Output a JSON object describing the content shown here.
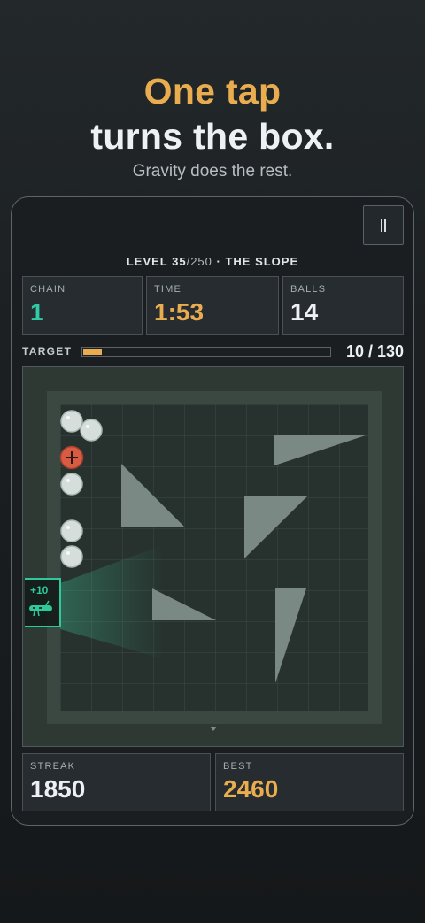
{
  "hero": {
    "line1": "One tap",
    "line2": "turns the box.",
    "subtitle": "Gravity does the rest."
  },
  "game": {
    "level_prefix": "LEVEL ",
    "level": "35",
    "level_total": "/250",
    "level_name": " · THE SLOPE",
    "stats": [
      {
        "label": "CHAIN",
        "value": "1",
        "color": "#33c9a4"
      },
      {
        "label": "TIME",
        "value": "1:53",
        "color": "#e9ad4f"
      },
      {
        "label": "BALLS",
        "value": "14",
        "color": "#eef1f3"
      }
    ],
    "target": {
      "label": "TARGET",
      "current": 10,
      "total": 130,
      "count_text": "10 / 130",
      "progress": 0.077
    },
    "exit": {
      "bonus": "+10",
      "icon": "creature-icon"
    },
    "bottom": [
      {
        "label": "STREAK",
        "value": "1850",
        "color": "#eef1f3"
      },
      {
        "label": "BEST",
        "value": "2460",
        "color": "#e9ad4f"
      }
    ],
    "colors": {
      "accent": "#e9ad4f",
      "teal": "#2ec99a",
      "danger": "#d75c43"
    }
  }
}
